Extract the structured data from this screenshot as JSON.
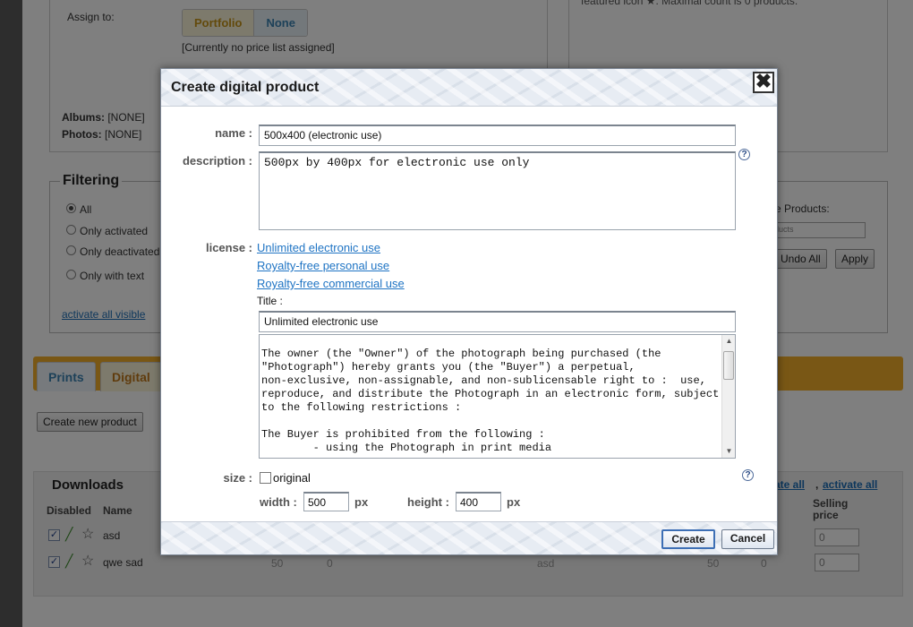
{
  "background": {
    "assign_label": "Assign to:",
    "assign_options": [
      "Portfolio",
      "None"
    ],
    "price_list_note": "[Currently no price list assigned]",
    "albums_label": "Albums:",
    "albums_value": "[NONE]",
    "photos_label": "Photos:",
    "photos_value": "[NONE]",
    "featured_note": "featured icon ★. Maximal count is 0 products.",
    "filtering_legend": "Filtering",
    "filter_options": [
      "All",
      "Only activated",
      "Only deactivated",
      "Only with text"
    ],
    "activate_all_visible": "activate all visible",
    "use_products_label": "se Products:",
    "use_products_select": "ducts",
    "undo_all": "Undo All",
    "apply": "Apply",
    "tabs": [
      "Prints",
      "Digital"
    ],
    "create_new_product": "Create new product",
    "downloads_title": "Downloads",
    "col_disabled": "Disabled",
    "col_name": "Name",
    "col_selling_price": "Selling price",
    "rows": [
      {
        "name": "asd",
        "price": "0"
      },
      {
        "name": "qwe sad",
        "price": "0"
      }
    ],
    "row2_extra": [
      "50",
      "0",
      "50",
      "0",
      "asd"
    ],
    "activate_all_links": [
      "ate all",
      "activate all"
    ]
  },
  "dialog": {
    "title": "Create digital product",
    "close_glyph": "✖",
    "name_label": "name :",
    "name_value": "500x400 (electronic use)",
    "description_label": "description :",
    "description_value": "500px by 400px for electronic use only",
    "help_glyph": "?",
    "license_label": "license :",
    "license_links": [
      "Unlimited electronic use",
      "Royalty-free personal use",
      "Royalty-free commercial use"
    ],
    "title_label": "Title :",
    "title_value": "Unlimited electronic use",
    "license_text": "The owner (the \"Owner\") of the photograph being purchased (the\n\"Photograph\") hereby grants you (the \"Buyer\") a perpetual,\nnon-exclusive, non-assignable, and non-sublicensable right to :  use,\nreproduce, and distribute the Photograph in an electronic form, subject\nto the following restrictions :\n\nThe Buyer is prohibited from the following :\n        - using the Photograph in print media",
    "size_label": "size :",
    "original_label": "original",
    "width_label": "width :",
    "width_value": "500",
    "height_label": "height :",
    "height_value": "400",
    "unit_px": "px",
    "create_label": "Create",
    "cancel_label": "Cancel"
  },
  "colors": {
    "link": "#1f74c4",
    "overlay": "rgba(0,0,0,0.5)",
    "portfolio_text": "#c69418",
    "none_text": "#3b82b2",
    "digital_bar": "#f2ae2b"
  }
}
